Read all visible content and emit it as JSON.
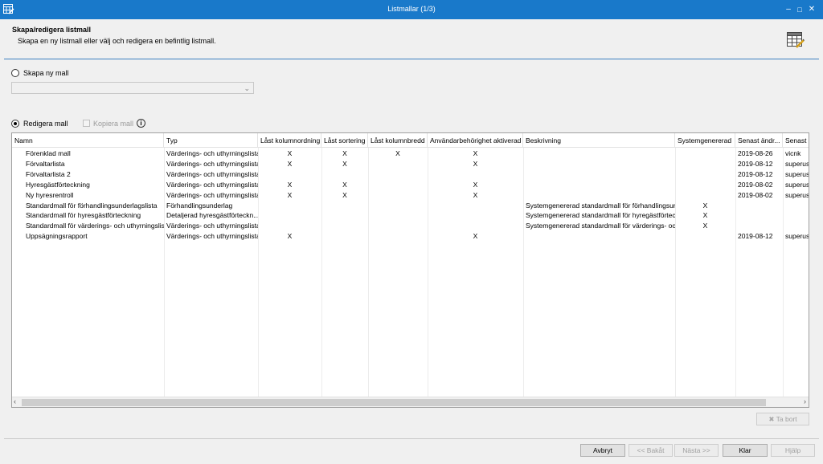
{
  "window": {
    "title": "Listmallar (1/3)",
    "minimize_glyph": "–",
    "maximize_glyph": "□",
    "close_glyph": "✕"
  },
  "header": {
    "title": "Skapa/redigera listmall",
    "subtitle": "Skapa en ny listmall eller välj och redigera en befintlig listmall."
  },
  "options": {
    "create_label": "Skapa ny mall",
    "create_selected": false,
    "template_combo_value": "",
    "edit_label": "Redigera mall",
    "edit_selected": true,
    "copy_label": "Kopiera mall",
    "copy_checked": false
  },
  "grid": {
    "columns": [
      "Namn",
      "Typ",
      "Låst kolumnordning",
      "Låst sortering",
      "Låst kolumnbredd",
      "Användarbehörighet aktiverad",
      "Beskrivning",
      "Systemgenererad",
      "Senast ändr...",
      "Senast ä"
    ],
    "rows": [
      [
        "Förenklad mall",
        "Värderings- och uthyrningslista",
        "X",
        "X",
        "X",
        "X",
        "",
        "",
        "2019-08-26",
        "vicnk"
      ],
      [
        "Förvaltarlista",
        "Värderings- och uthyrningslista",
        "X",
        "X",
        "",
        "X",
        "",
        "",
        "2019-08-12",
        "superuse"
      ],
      [
        "Förvaltarlista 2",
        "Värderings- och uthyrningslista",
        "",
        "",
        "",
        "",
        "",
        "",
        "2019-08-12",
        "superuse"
      ],
      [
        "Hyresgästförteckning",
        "Värderings- och uthyrningslista",
        "X",
        "X",
        "",
        "X",
        "",
        "",
        "2019-08-02",
        "superuse"
      ],
      [
        "Ny hyresrentroll",
        "Värderings- och uthyrningslista",
        "X",
        "X",
        "",
        "X",
        "",
        "",
        "2019-08-02",
        "superuse"
      ],
      [
        "Standardmall för förhandlingsunderlagslista",
        "Förhandlingsunderlag",
        "",
        "",
        "",
        "",
        "Systemgenererad standardmall för förhandlingsun...",
        "X",
        "",
        ""
      ],
      [
        "Standardmall för hyresgästförteckning",
        "Detaljerad hyresgästförteckn...",
        "",
        "",
        "",
        "",
        "Systemgenererad standardmall för hyregästförtec...",
        "X",
        "",
        ""
      ],
      [
        "Standardmall för värderings- och uthyrningslista",
        "Värderings- och uthyrningslista",
        "",
        "",
        "",
        "",
        "Systemgenererad standardmall för värderings- oc...",
        "X",
        "",
        ""
      ],
      [
        "Uppsägningsrapport",
        "Värderings- och uthyrningslista",
        "X",
        "",
        "",
        "X",
        "",
        "",
        "2019-08-12",
        "superuse"
      ]
    ]
  },
  "buttons": {
    "delete": "Ta bort",
    "cancel": "Avbryt",
    "back": "<< Bakåt",
    "next": "Nästa >>",
    "finish": "Klar",
    "help": "Hjälp"
  },
  "colors": {
    "titlebar": "#1979ca",
    "accent_line": "#3c7fc1"
  }
}
